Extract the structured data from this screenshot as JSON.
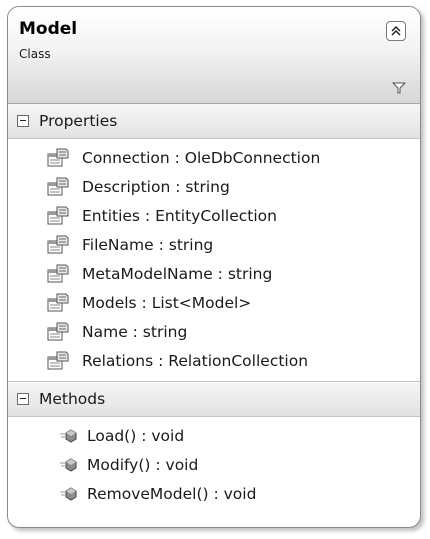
{
  "class": {
    "name": "Model",
    "stereotype": "Class"
  },
  "properties": {
    "header": "Properties",
    "items": [
      "Connection : OleDbConnection",
      "Description : string",
      "Entities : EntityCollection",
      "FileName : string",
      "MetaModelName : string",
      "Models : List<Model>",
      "Name : string",
      "Relations : RelationCollection"
    ]
  },
  "methods": {
    "header": "Methods",
    "items": [
      "Load() : void",
      "Modify() : void",
      "RemoveModel() : void"
    ]
  },
  "icons": {
    "collapse": "double-chevron-up-icon",
    "filter": "filter-icon",
    "property": "property-icon",
    "method": "method-icon",
    "toggle": "minus-icon"
  }
}
